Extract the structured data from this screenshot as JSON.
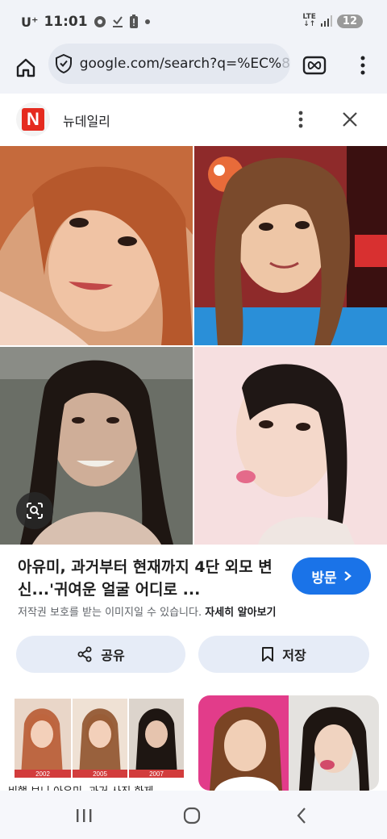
{
  "status_bar": {
    "carrier": "U⁺",
    "time": "11:01",
    "network": "LTE",
    "battery": "12"
  },
  "browser": {
    "url_visible": "google.com/search?q=%EC%",
    "url_faded": "8"
  },
  "source": {
    "logo_letter": "N",
    "name": "뉴데일리"
  },
  "result": {
    "title": "아유미, 과거부터 현재까지 4단 외모 변신...'귀여운 얼굴 어디로 ...",
    "visit_label": "방문",
    "copyright_text": "저작권 보호를 받는 이미지일 수 있습니다.",
    "learn_more": "자세히 알아보기",
    "share_label": "공유",
    "save_label": "저장"
  },
  "related": {
    "years": [
      "2002",
      "2005",
      "2007"
    ],
    "caption": "비행 보니 아유미, 과거 사진 화제"
  },
  "colors": {
    "accent": "#1a73e8",
    "source_red": "#e52b1f",
    "pill_bg": "#e6ecf7",
    "toolbar_bg": "#f1f3f8"
  }
}
